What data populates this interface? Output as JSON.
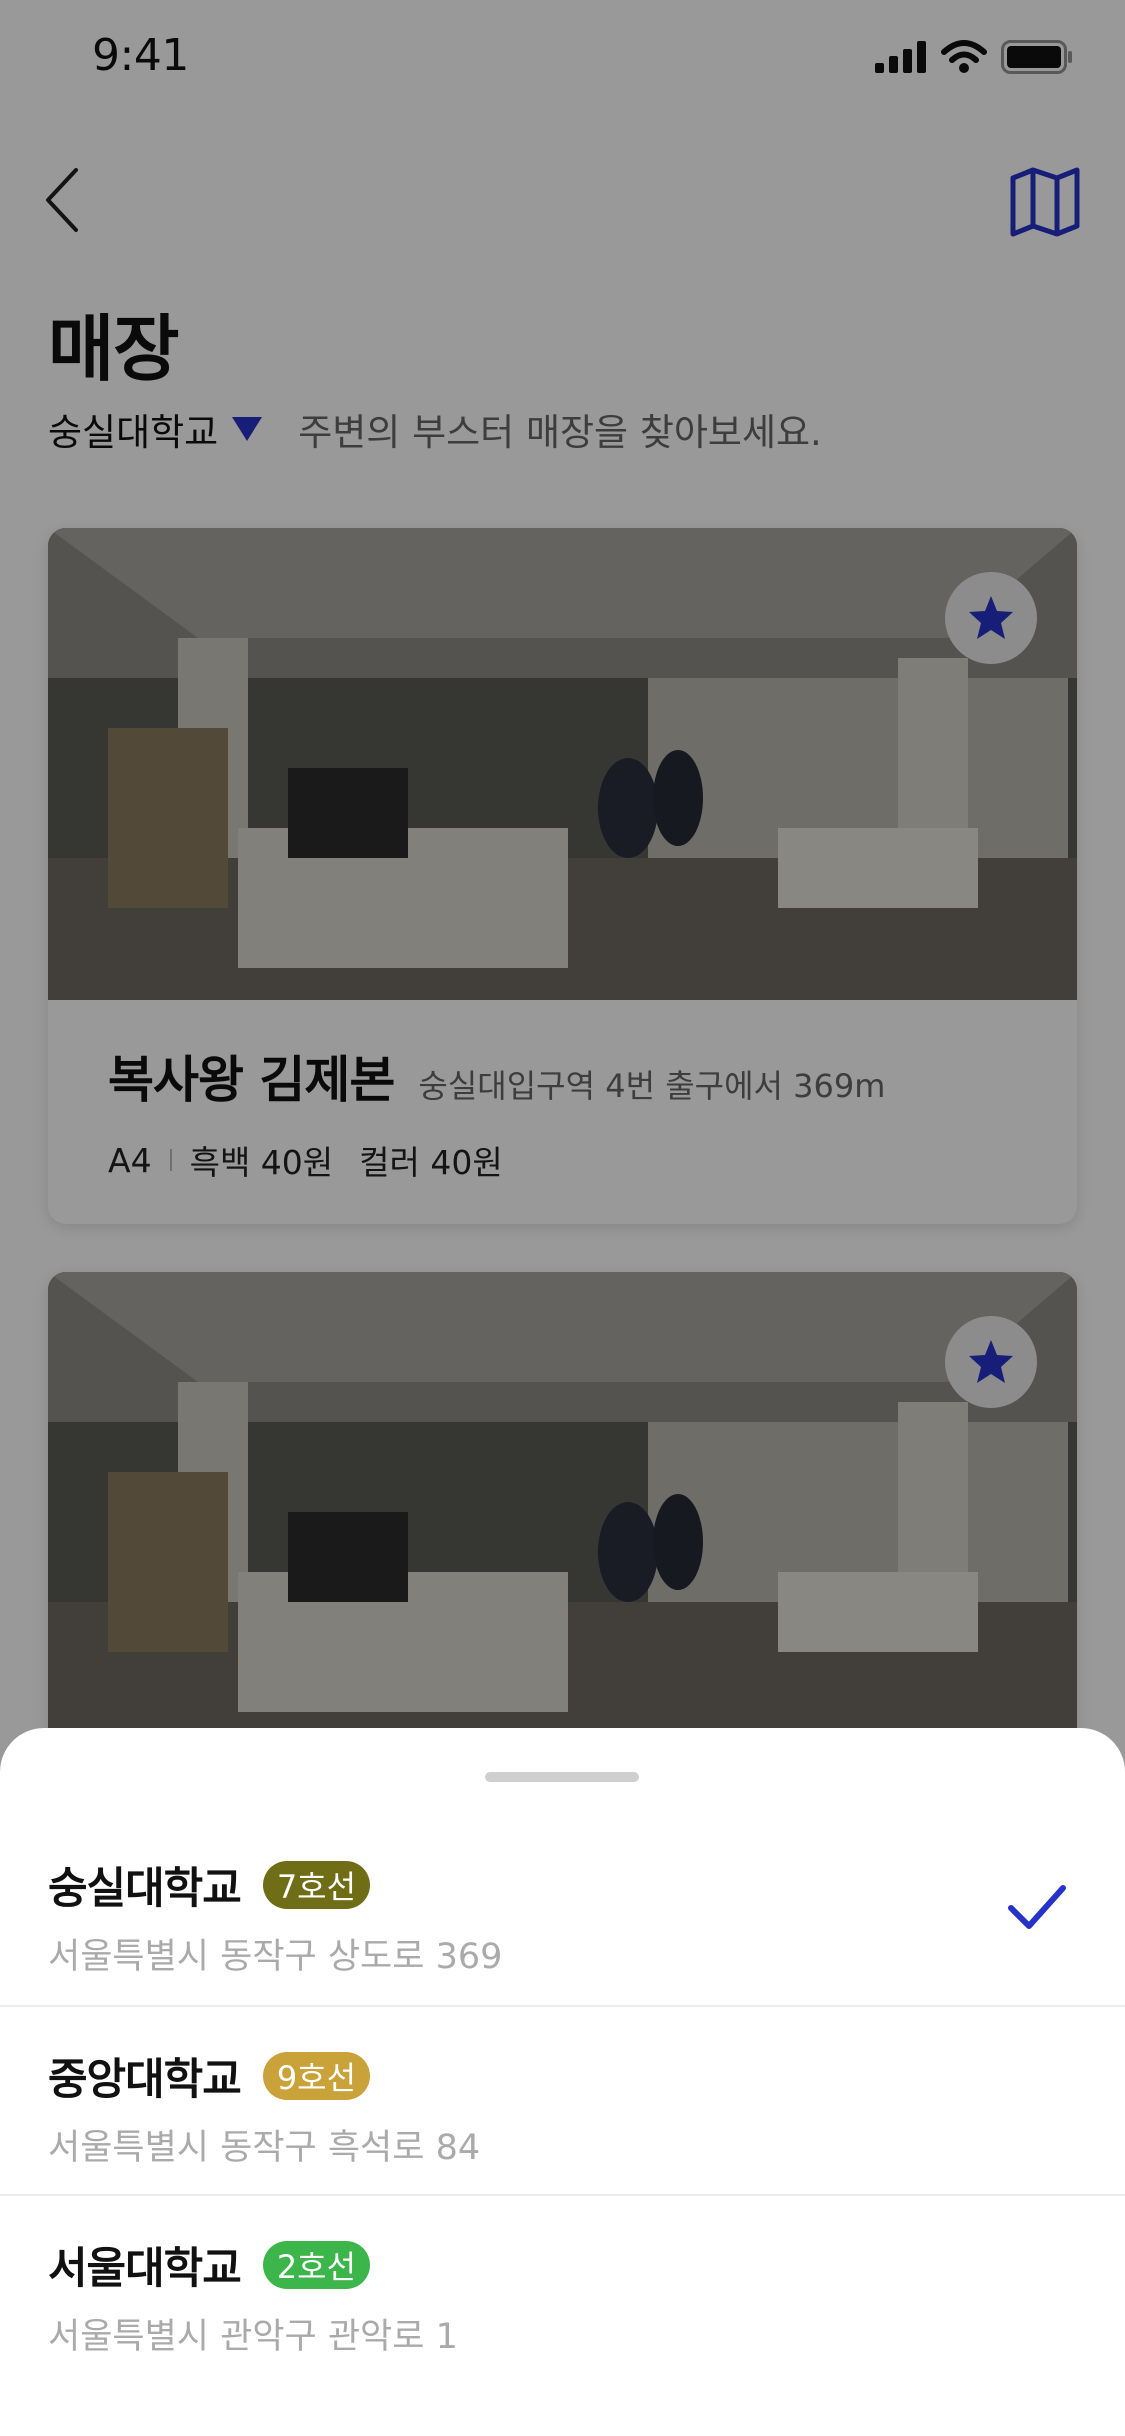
{
  "status_bar": {
    "time": "9:41"
  },
  "header": {
    "title": "매장"
  },
  "location": {
    "name": "숭실대학교",
    "hint": "주변의 부스터 매장을 찾아보세요."
  },
  "stores": [
    {
      "name": "복사왕 김제본",
      "distance": "숭실대입구역 4번 출구에서 369m",
      "paper": "A4",
      "bw_price": "흑백 40원",
      "color_price": "컬러 40원"
    }
  ],
  "sheet": {
    "options": [
      {
        "name": "숭실대학교",
        "line": "7호선",
        "line_color": "#6f6e16",
        "address": "서울특별시 동작구 상도로 369",
        "selected": true
      },
      {
        "name": "중앙대학교",
        "line": "9호선",
        "line_color": "#c9a23a",
        "address": "서울특별시 동작구 흑석로 84",
        "selected": false
      },
      {
        "name": "서울대학교",
        "line": "2호선",
        "line_color": "#3cb54a",
        "address": "서울특별시 관악구 관악로 1",
        "selected": false
      }
    ]
  },
  "colors": {
    "accent": "#2633c9"
  },
  "icons": {
    "back": "chevron-left-icon",
    "map": "map-icon",
    "favorite": "star-icon",
    "check": "checkmark-icon"
  }
}
